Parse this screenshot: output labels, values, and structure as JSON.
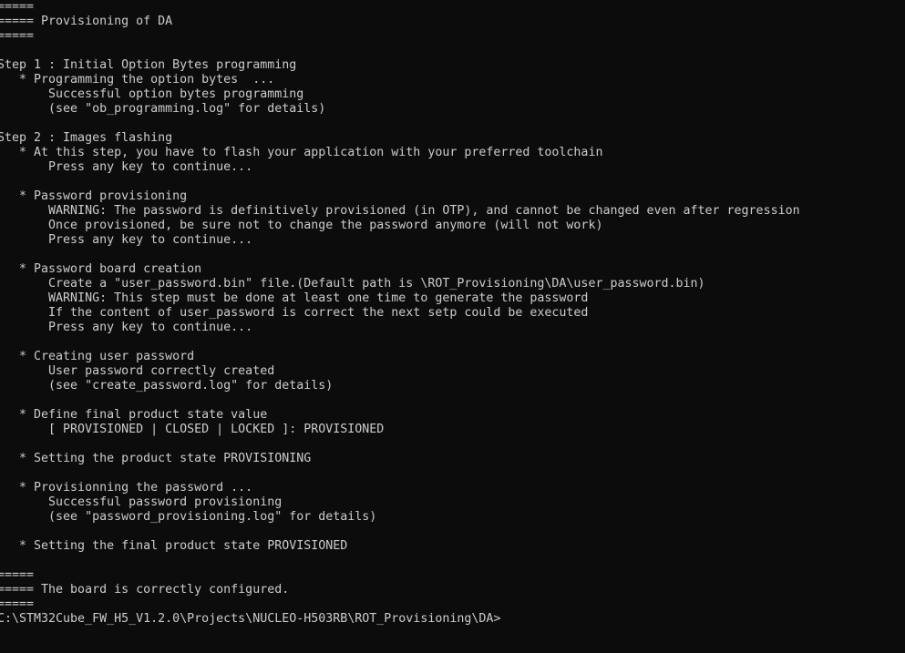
{
  "window": {
    "title": "C:\\STM32Cube_FW_H5_V1.2.0\\Projects\\NUCLEO-H503RB\\ROT_Provisioning\\DA",
    "type": "windows-command-prompt",
    "background_color": "#0c0c0c",
    "foreground_color": "#cccccc",
    "columns": 123,
    "rows": 45
  },
  "console": {
    "banner": {
      "rule_top": "=====",
      "title_line": "===== Provisioning of DA",
      "rule_bottom": "====="
    },
    "steps": [
      {
        "heading": "Step 1 : Initial Option Bytes programming",
        "entries": [
          {
            "bullet": "   * Programming the option bytes  ...",
            "details": [
              "       Successful option bytes programming",
              "       (see \"ob_programming.log\" for details)"
            ]
          }
        ]
      },
      {
        "heading": "Step 2 : Images flashing",
        "entries": [
          {
            "bullet": "   * At this step, you have to flash your application with your preferred toolchain",
            "details": [
              "       Press any key to continue..."
            ]
          },
          {
            "bullet": "   * Password provisioning",
            "details": [
              "       WARNING: The password is definitively provisioned (in OTP), and cannot be changed even after regression",
              "       Once provisioned, be sure not to change the password anymore (will not work)",
              "       Press any key to continue..."
            ]
          },
          {
            "bullet": "   * Password board creation",
            "details": [
              "       Create a \"user_password.bin\" file.(Default path is \\ROT_Provisioning\\DA\\user_password.bin)",
              "       WARNING: This step must be done at least one time to generate the password",
              "       If the content of user_password is correct the next setp could be executed",
              "       Press any key to continue..."
            ]
          },
          {
            "bullet": "   * Creating user password",
            "details": [
              "       User password correctly created",
              "       (see \"create_password.log\" for details)"
            ]
          },
          {
            "bullet": "   * Define final product state value",
            "details": [
              "       [ PROVISIONED | CLOSED | LOCKED ]: PROVISIONED"
            ]
          },
          {
            "bullet": "   * Setting the product state PROVISIONING",
            "details": []
          },
          {
            "bullet": "   * Provisionning the password ...",
            "details": [
              "       Successful password provisioning",
              "       (see \"password_provisioning.log\" for details)"
            ]
          },
          {
            "bullet": "   * Setting the final product state PROVISIONED",
            "details": []
          }
        ]
      }
    ],
    "footer": {
      "rule_top": "=====",
      "message_line": "===== The board is correctly configured.",
      "rule_bottom": "====="
    },
    "prompt": {
      "path": "C:\\STM32Cube_FW_H5_V1.2.0\\Projects\\NUCLEO-H503RB\\ROT_Provisioning\\DA",
      "symbol": ">",
      "input": ""
    },
    "lines": [
      "=====",
      "===== Provisioning of DA",
      "=====",
      "",
      "Step 1 : Initial Option Bytes programming",
      "   * Programming the option bytes  ...",
      "       Successful option bytes programming",
      "       (see \"ob_programming.log\" for details)",
      "",
      "Step 2 : Images flashing",
      "   * At this step, you have to flash your application with your preferred toolchain",
      "       Press any key to continue...",
      "",
      "   * Password provisioning",
      "       WARNING: The password is definitively provisioned (in OTP), and cannot be changed even after regression",
      "       Once provisioned, be sure not to change the password anymore (will not work)",
      "       Press any key to continue...",
      "",
      "   * Password board creation",
      "       Create a \"user_password.bin\" file.(Default path is \\ROT_Provisioning\\DA\\user_password.bin)",
      "       WARNING: This step must be done at least one time to generate the password",
      "       If the content of user_password is correct the next setp could be executed",
      "       Press any key to continue...",
      "",
      "   * Creating user password",
      "       User password correctly created",
      "       (see \"create_password.log\" for details)",
      "",
      "   * Define final product state value",
      "       [ PROVISIONED | CLOSED | LOCKED ]: PROVISIONED",
      "",
      "   * Setting the product state PROVISIONING",
      "",
      "   * Provisionning the password ...",
      "       Successful password provisioning",
      "       (see \"password_provisioning.log\" for details)",
      "",
      "   * Setting the final product state PROVISIONED",
      "",
      "=====",
      "===== The board is correctly configured.",
      "=====",
      "C:\\STM32Cube_FW_H5_V1.2.0\\Projects\\NUCLEO-H503RB\\ROT_Provisioning\\DA>"
    ]
  }
}
